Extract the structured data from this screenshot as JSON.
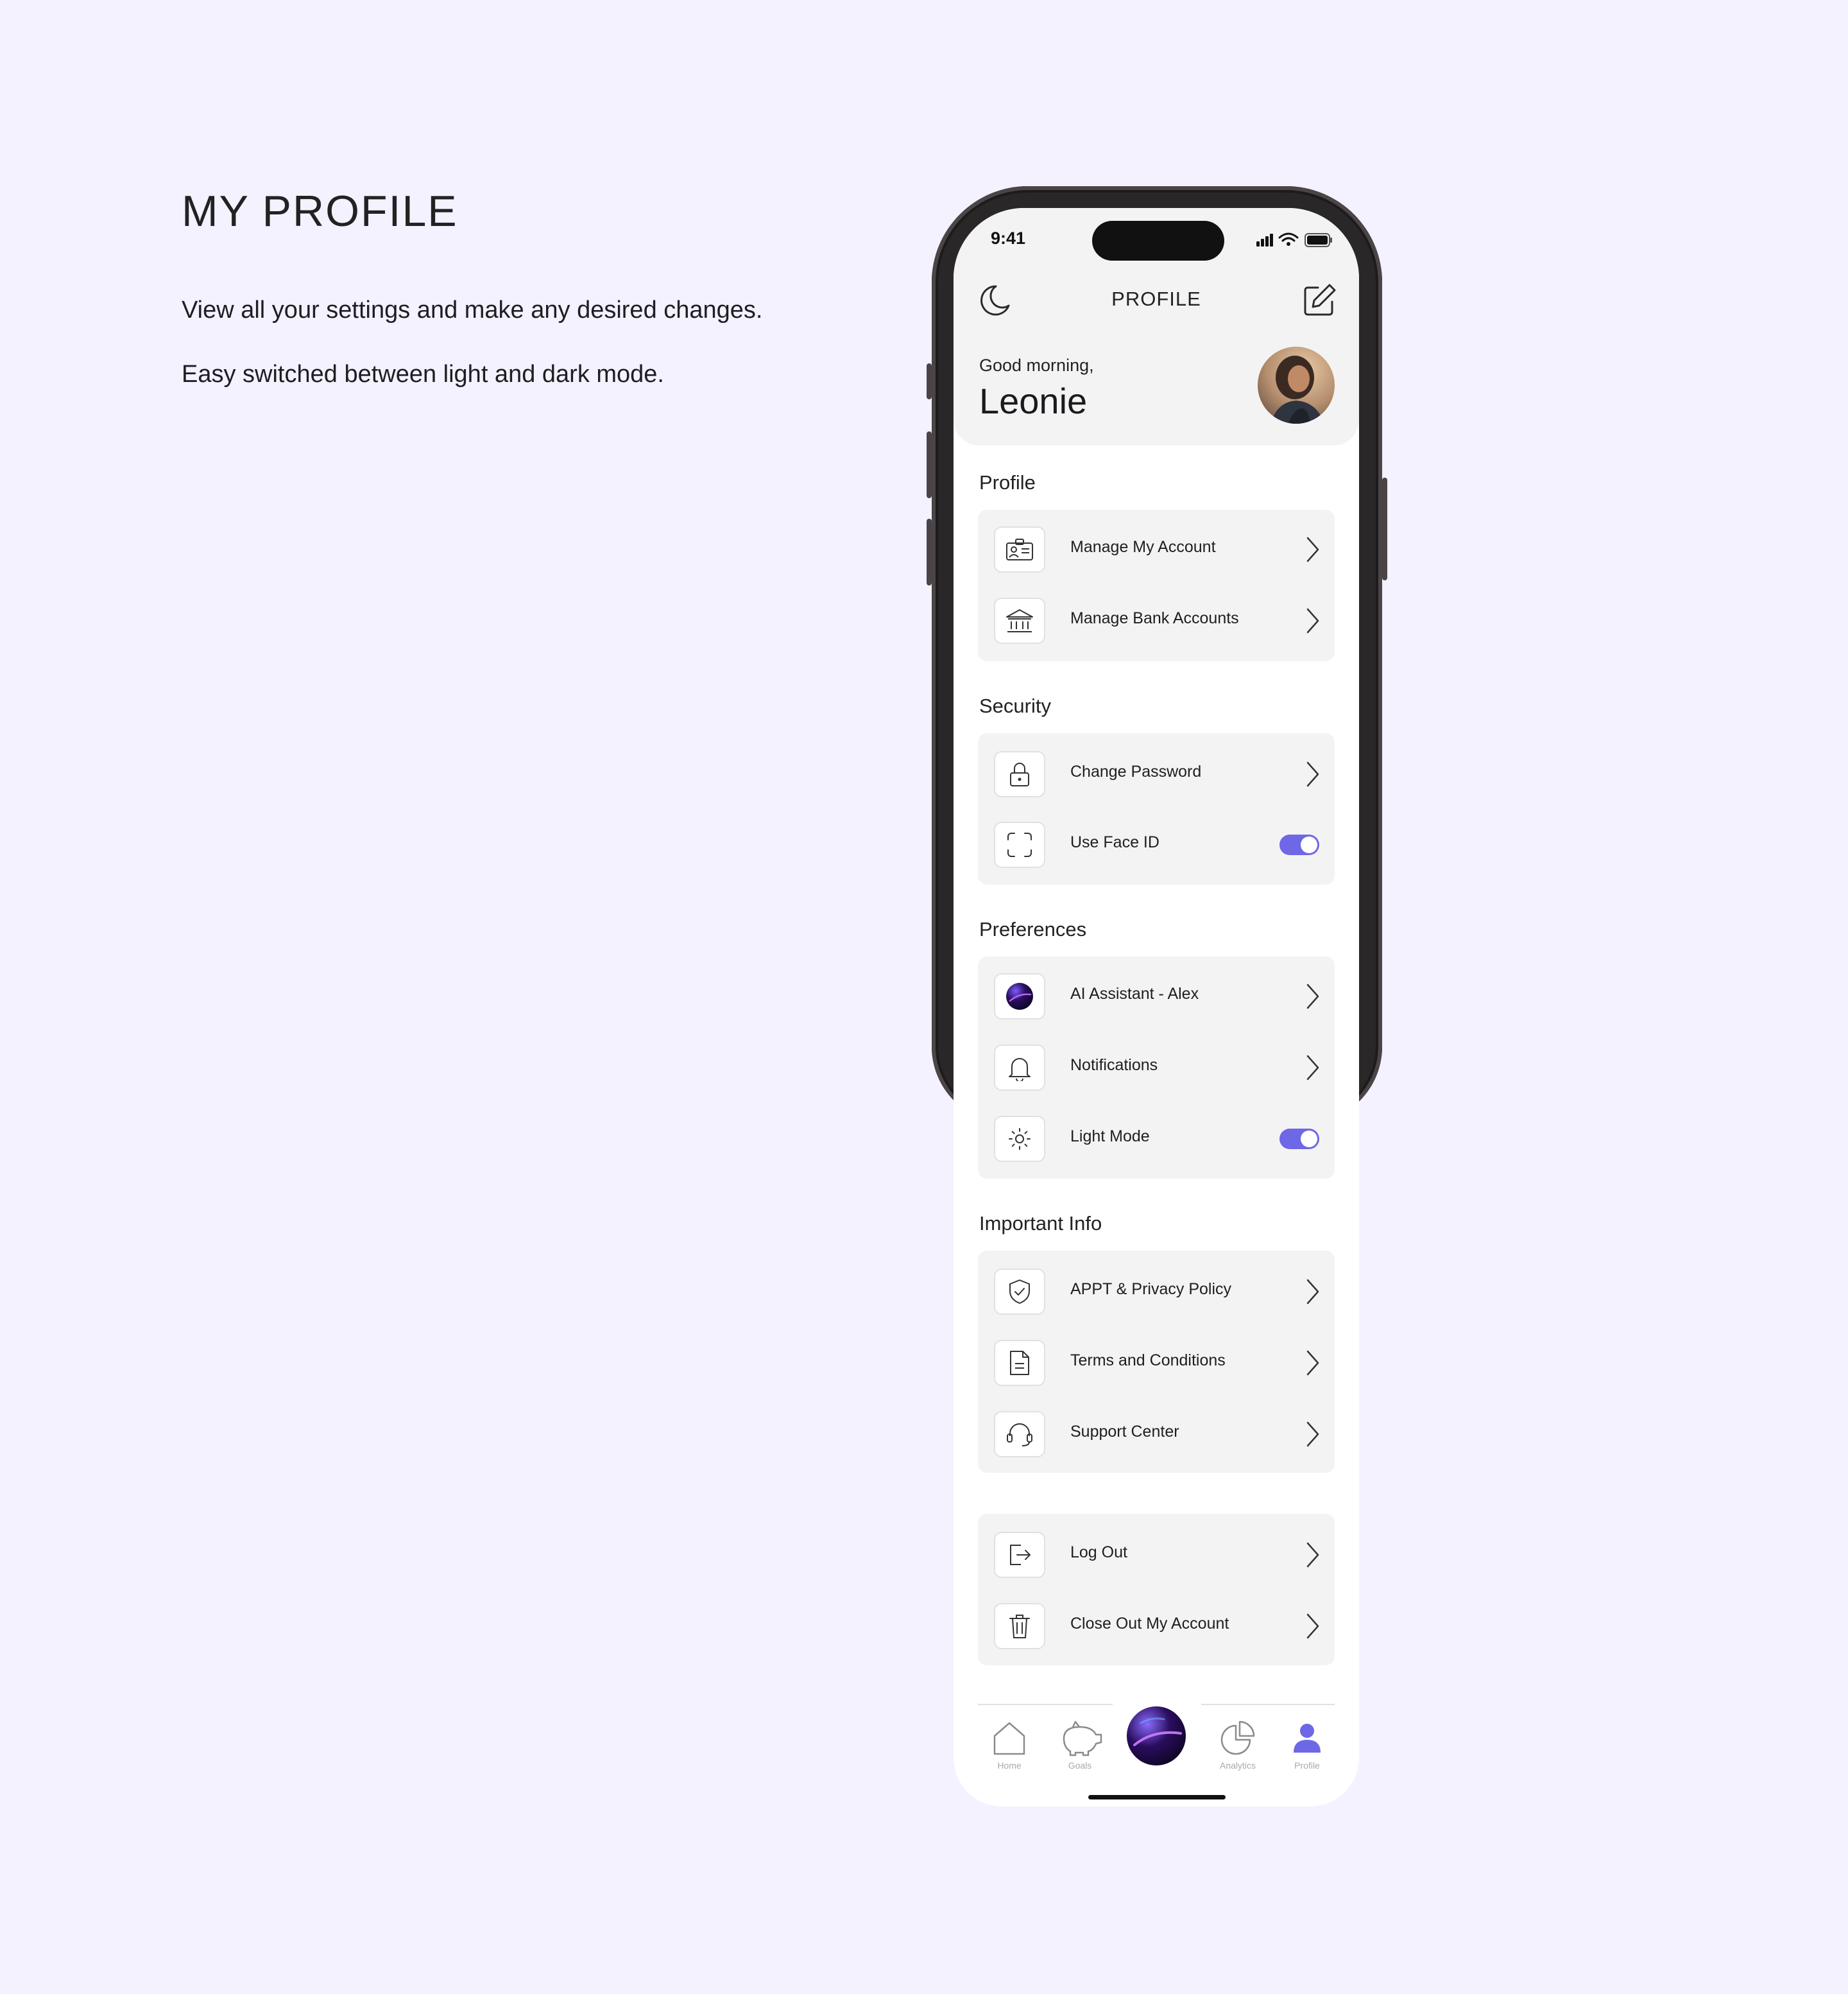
{
  "intro": {
    "title": "MY PROFILE",
    "description_1": "View all your settings and make any desired changes.",
    "description_2": "Easy switched between light and dark mode."
  },
  "status_bar": {
    "time": "9:41"
  },
  "header": {
    "title": "PROFILE",
    "greeting": "Good morning,",
    "user_name": "Leonie"
  },
  "sections": [
    {
      "title": "Profile",
      "items": [
        {
          "label": "Manage My Account",
          "icon": "id-card-icon",
          "control": "chevron"
        },
        {
          "label": "Manage Bank Accounts",
          "icon": "bank-icon",
          "control": "chevron"
        }
      ]
    },
    {
      "title": "Security",
      "items": [
        {
          "label": "Change Password",
          "icon": "lock-icon",
          "control": "chevron"
        },
        {
          "label": "Use Face ID",
          "icon": "face-id-icon",
          "control": "toggle",
          "value": true
        }
      ]
    },
    {
      "title": "Preferences",
      "items": [
        {
          "label": "AI Assistant - Alex",
          "icon": "ai-orb-icon",
          "control": "chevron"
        },
        {
          "label": "Notifications",
          "icon": "bell-icon",
          "control": "chevron"
        },
        {
          "label": "Light Mode",
          "icon": "sun-icon",
          "control": "toggle",
          "value": true
        }
      ]
    },
    {
      "title": "Important Info",
      "items": [
        {
          "label": "APPT & Privacy Policy",
          "icon": "shield-check-icon",
          "control": "chevron"
        },
        {
          "label": "Terms and Conditions",
          "icon": "document-icon",
          "control": "chevron"
        },
        {
          "label": "Support Center",
          "icon": "headset-icon",
          "control": "chevron"
        }
      ]
    },
    {
      "title": "",
      "items": [
        {
          "label": "Log Out",
          "icon": "logout-icon",
          "control": "chevron"
        },
        {
          "label": "Close Out My Account",
          "icon": "trash-icon",
          "control": "chevron"
        }
      ]
    }
  ],
  "tab_bar": {
    "tabs": [
      {
        "label": "Home",
        "icon": "home-icon"
      },
      {
        "label": "Goals",
        "icon": "piggy-bank-icon"
      },
      {
        "label": "Analytics",
        "icon": "pie-chart-icon"
      },
      {
        "label": "Profile",
        "icon": "user-icon",
        "active": true
      }
    ],
    "center_icon": "ai-orb-icon"
  },
  "colors": {
    "background": "#F3F2FE",
    "accent": "#6E67E6",
    "card": "#F4F3F3",
    "text": "#1E1E22",
    "muted": "#A9A7AB"
  }
}
